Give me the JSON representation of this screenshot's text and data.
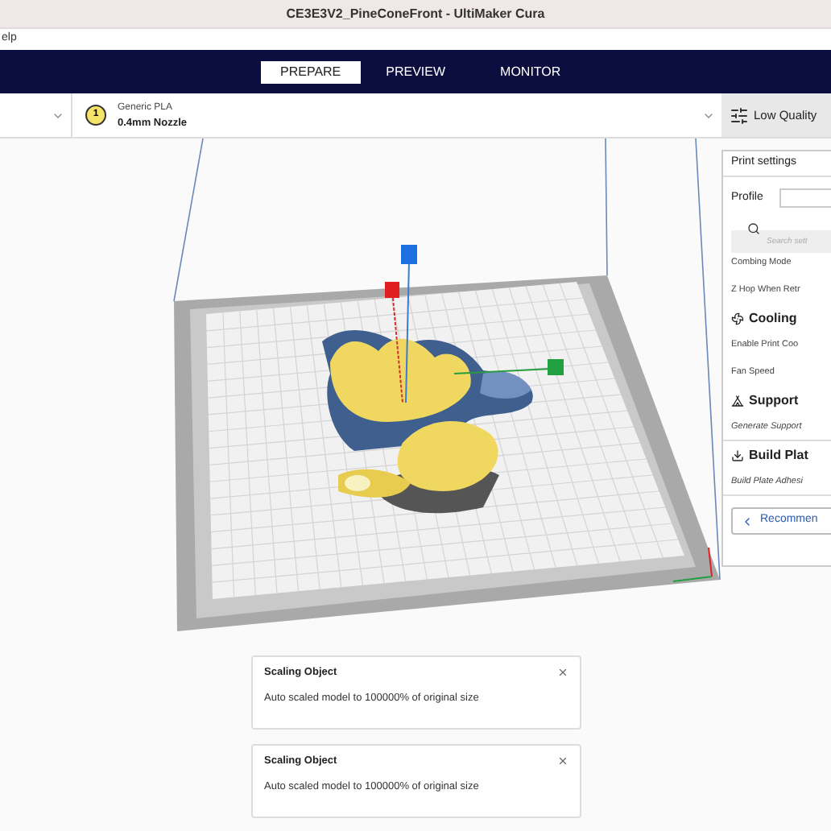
{
  "window": {
    "title": "CE3E3V2_PineConeFront - UltiMaker Cura"
  },
  "menu": [
    "elp"
  ],
  "tabs": [
    {
      "label": "PREPARE",
      "selected": true
    },
    {
      "label": "PREVIEW",
      "selected": false
    },
    {
      "label": "MONITOR",
      "selected": false
    }
  ],
  "toolbar": {
    "extruder_number": "1",
    "material": "Generic PLA",
    "nozzle": "0.4mm Nozzle",
    "profile": "Low Quality"
  },
  "print_settings": {
    "title": "Print settings",
    "profile_label": "Profile",
    "search": {
      "placeholder": "Search sett"
    },
    "items": [
      {
        "kind": "setting",
        "label": "Combing Mode"
      },
      {
        "kind": "setting",
        "label": "Z Hop When Retr"
      },
      {
        "kind": "header",
        "label": "Cooling"
      },
      {
        "kind": "setting",
        "label": "Enable Print Coo"
      },
      {
        "kind": "setting",
        "label": "Fan Speed"
      },
      {
        "kind": "header",
        "label": "Support"
      },
      {
        "kind": "hint",
        "label": "Generate Support"
      },
      {
        "kind": "header",
        "label": "Build Plat"
      },
      {
        "kind": "hint",
        "label": "Build Plate Adhesi"
      }
    ],
    "button": "Recommen"
  },
  "notifications": [
    {
      "title": "Scaling Object",
      "message": "Auto scaled model to 100000% of original size"
    },
    {
      "title": "Scaling Object",
      "message": "Auto scaled model to 100000% of original size"
    }
  ]
}
